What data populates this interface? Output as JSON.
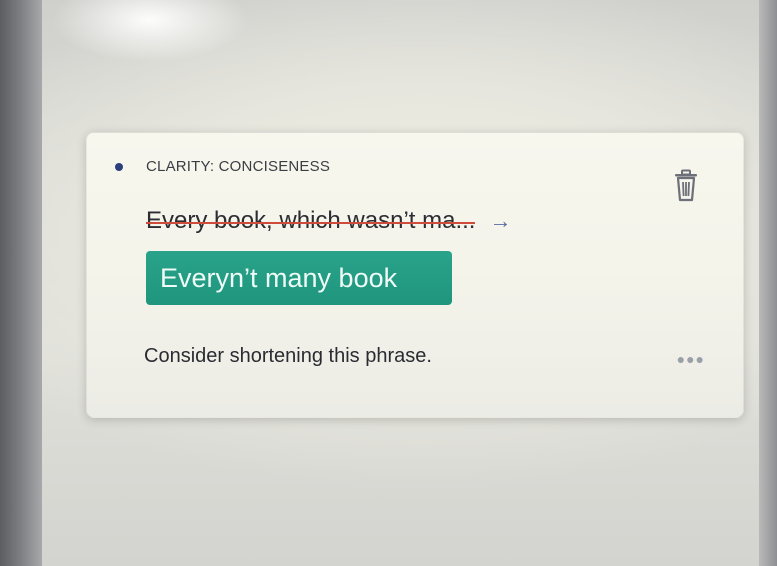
{
  "suggestion_card": {
    "category": "CLARITY: CONCISENESS",
    "original_text": "Every book, which wasn’t ma...",
    "arrow_icon": "arrow-right-icon",
    "replacement_text": "Everyn’t many book",
    "message": "Consider shortening this phrase.",
    "more_icon": "more-options-icon",
    "delete_icon": "trash-icon"
  },
  "colors": {
    "accent_dot": "#2c3f7a",
    "strike": "#cf4b3c",
    "replacement_bg": "#1f957d"
  }
}
